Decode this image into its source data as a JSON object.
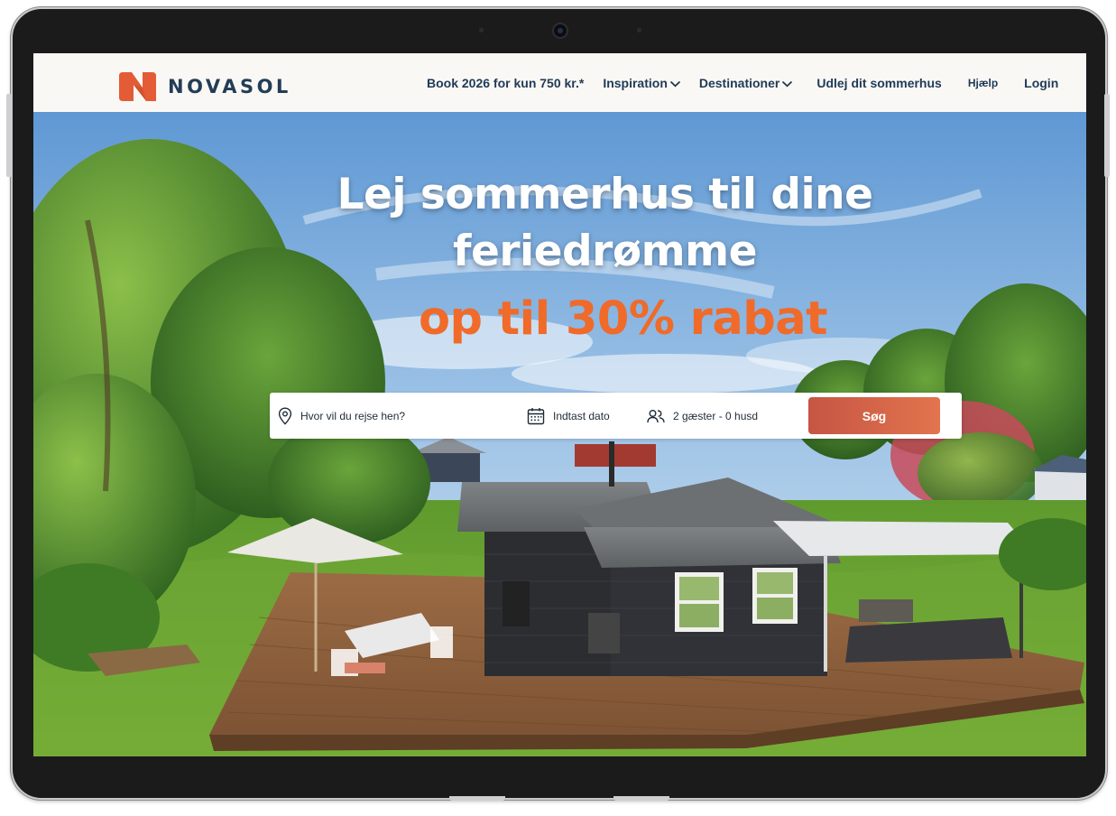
{
  "brand": {
    "name": "NOVASOL",
    "logo_icon": "novasol-n-logo",
    "logo_color": "#e35c36",
    "text_color": "#233d57"
  },
  "nav": {
    "items": [
      {
        "label": "Book 2026 for kun 750 kr.*",
        "has_dropdown": false
      },
      {
        "label": "Inspiration",
        "has_dropdown": true,
        "icon": "chevron-down-icon"
      },
      {
        "label": "Destinationer",
        "has_dropdown": true,
        "icon": "chevron-down-icon"
      },
      {
        "label": "Udlej dit sommerhus",
        "has_dropdown": false
      },
      {
        "label": "Hjælp",
        "has_dropdown": false
      },
      {
        "label": "Login",
        "has_dropdown": false
      }
    ]
  },
  "hero": {
    "headline_line1": "Lej sommerhus til dine",
    "headline_line2": "feriedrømme",
    "discount": "op til 30% rabat",
    "discount_color": "#f06a2a",
    "image": "black-wooden-summer-house-with-terrace-and-garden"
  },
  "search": {
    "destination_placeholder": "Hvor vil du rejse hen?",
    "destination_icon": "map-pin-icon",
    "date_placeholder": "Indtast dato",
    "date_icon": "calendar-icon",
    "guests_value": "2 gæster - 0 husd",
    "guests_icon": "users-icon",
    "button_label": "Søg",
    "button_color": "#d4624a"
  }
}
